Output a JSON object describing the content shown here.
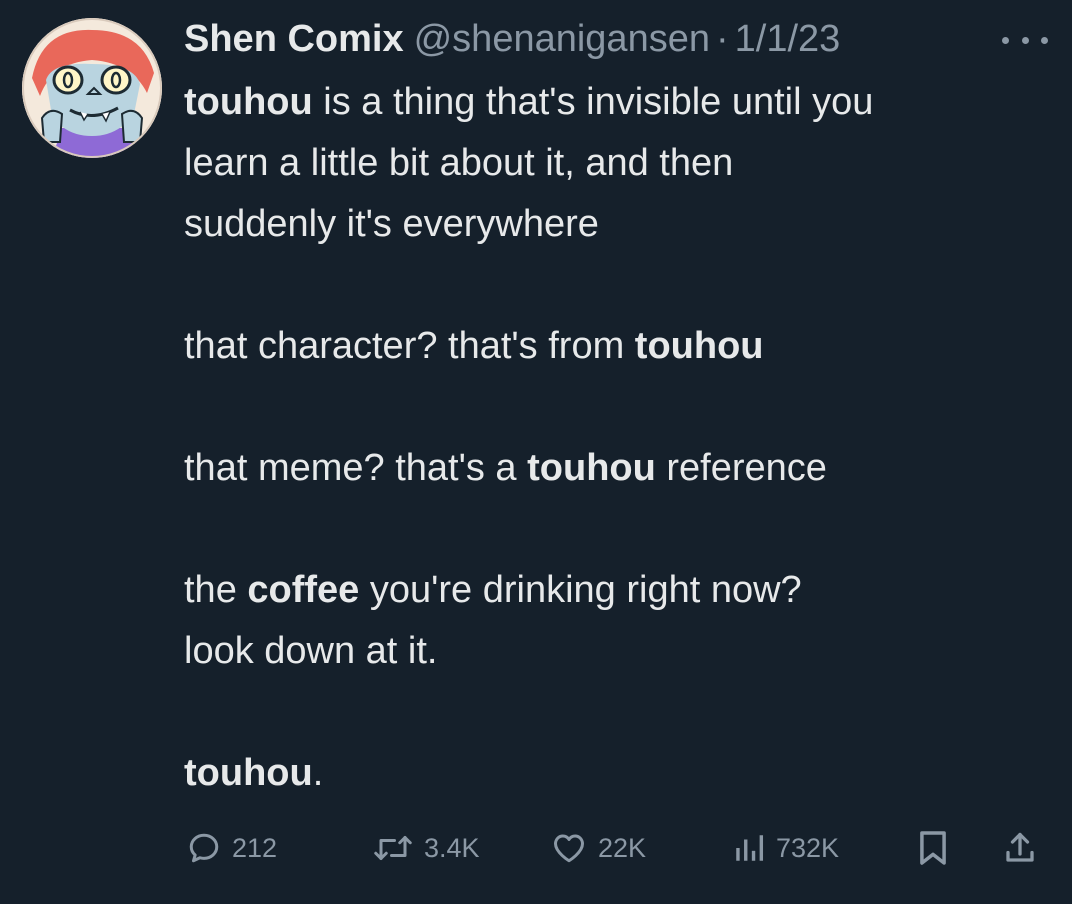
{
  "tweet": {
    "display_name": "Shen Comix",
    "handle": "@shenanigansen",
    "separator": "·",
    "timestamp": "1/1/23",
    "lines": {
      "l1": {
        "b": "touhou",
        "t": " is a thing that's invisible until you"
      },
      "l2": {
        "t": "learn a little bit about it, and then"
      },
      "l3": {
        "t": "suddenly it's everywhere"
      },
      "l4": {
        "t": "that character? that's from ",
        "b": "touhou"
      },
      "l5": {
        "t1": "that meme? that's a ",
        "b": "touhou",
        "t2": " reference"
      },
      "l6": {
        "t1": "the ",
        "b": "coffee",
        "t2": " you're drinking right now?"
      },
      "l7": {
        "t": "look down at it."
      },
      "l8": {
        "b": "touhou",
        "t": "."
      }
    },
    "actions": {
      "reply_count": "212",
      "retweet_count": "3.4K",
      "like_count": "22K",
      "views_count": "732K"
    },
    "icons": {
      "more": "more-dots-icon",
      "reply": "reply-bubble-icon",
      "retweet": "retweet-icon",
      "like": "heart-icon",
      "views": "analytics-bars-icon",
      "bookmark": "bookmark-icon",
      "share": "share-upload-icon"
    },
    "colors": {
      "background": "#15202b",
      "text": "#e7e9ea",
      "secondary_text": "#8b98a5"
    }
  }
}
